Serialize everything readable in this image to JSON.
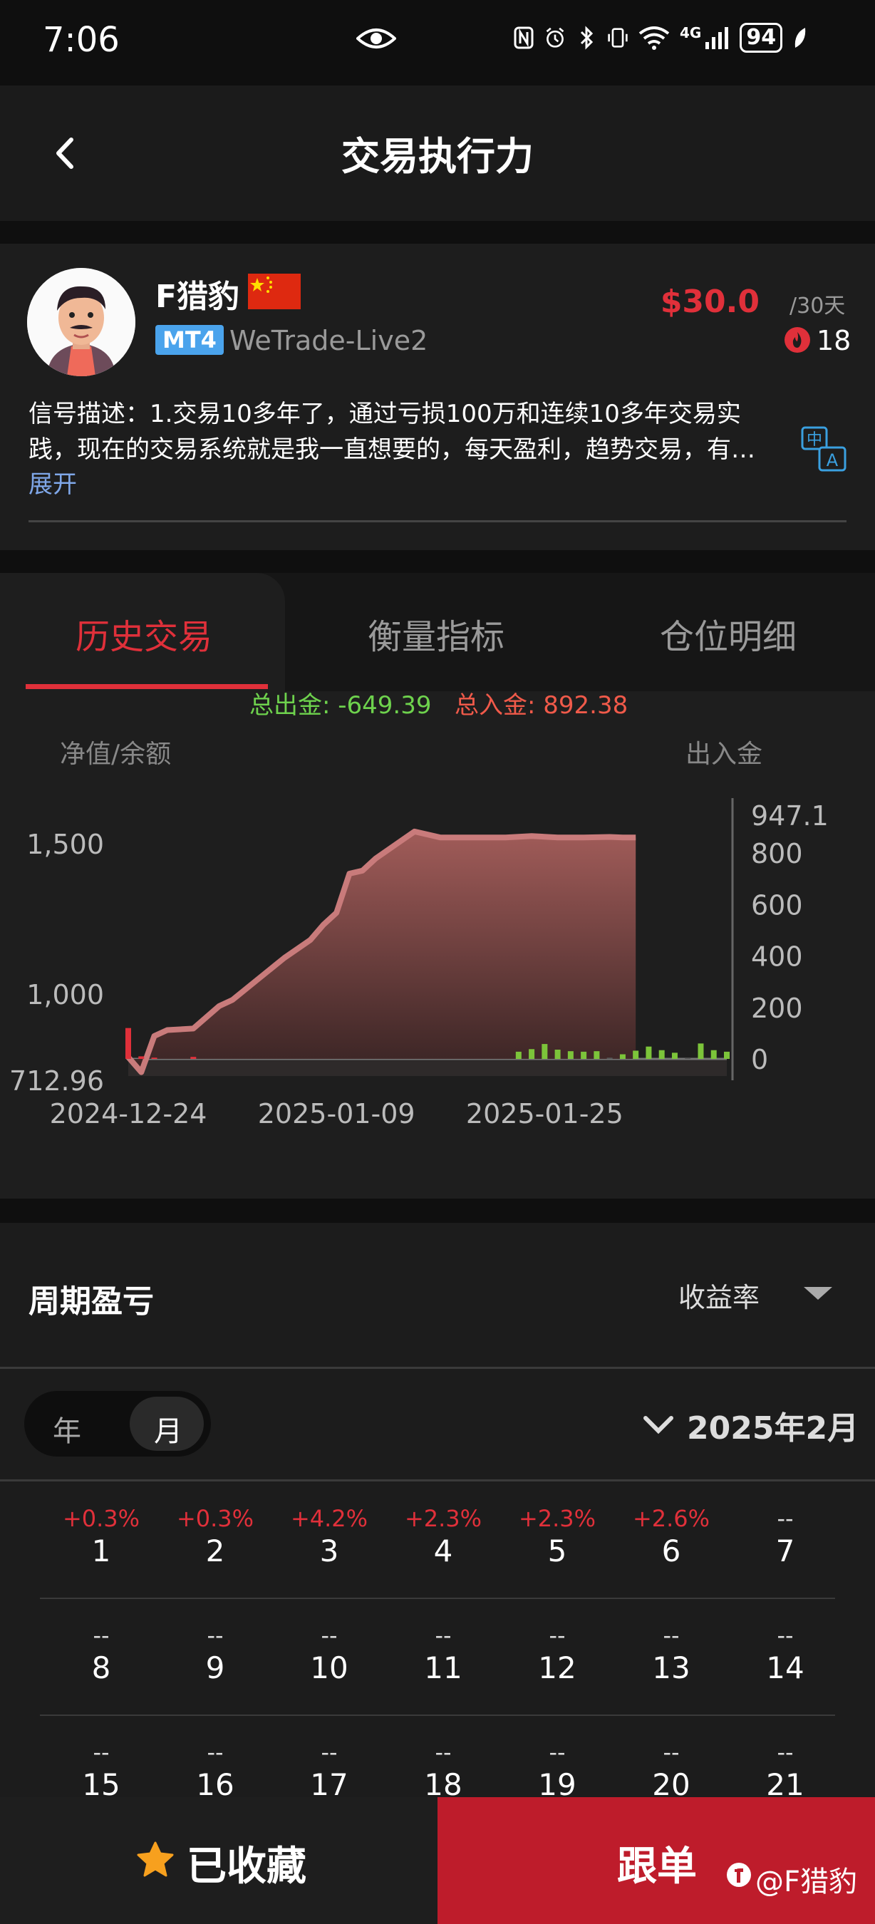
{
  "status_bar": {
    "time": "7:06",
    "network": "4G",
    "battery": "94"
  },
  "header": {
    "title": "交易执行力"
  },
  "trader": {
    "name": "F猎豹",
    "platform": "MT4",
    "server": "WeTrade-Live2",
    "price": "$30.0",
    "period": "/30天",
    "followers": "18",
    "description_line1": "信号描述：1.交易10多年了，通过亏损100万和连续10多年交易实",
    "description_line2": "践，现在的交易系统就是我一直想要的，每天盈利，趋势交易，有…",
    "expand": "展开"
  },
  "tabs": [
    {
      "label": "历史交易"
    },
    {
      "label": "衡量指标"
    },
    {
      "label": "仓位明细"
    }
  ],
  "totals": {
    "out": "总出金: -649.39",
    "in": "总入金: 892.38"
  },
  "chart": {
    "left_title": "净值/余额",
    "right_title": "出入金",
    "left_ticks": [
      "1,500",
      "1,000",
      "712.96"
    ],
    "right_ticks": [
      "947.1",
      "800",
      "600",
      "400",
      "200",
      "0"
    ],
    "x_ticks": [
      "2024-12-24",
      "2025-01-09",
      "2025-01-25"
    ]
  },
  "chart_data": {
    "type": "line",
    "x": [
      "2024-12-24",
      "2024-12-25",
      "2024-12-26",
      "2024-12-27",
      "2024-12-29",
      "2024-12-31",
      "2025-01-01",
      "2025-01-03",
      "2025-01-05",
      "2025-01-07",
      "2025-01-08",
      "2025-01-09",
      "2025-01-10",
      "2025-01-11",
      "2025-01-12",
      "2025-01-14",
      "2025-01-15",
      "2025-01-17",
      "2025-01-18",
      "2025-01-20",
      "2025-01-22",
      "2025-01-24",
      "2025-01-26",
      "2025-01-28",
      "2025-01-30",
      "2025-01-31",
      "2025-02-01"
    ],
    "series": [
      {
        "values": [
          790,
          740,
          860,
          880,
          885,
          960,
          980,
          1050,
          1120,
          1180,
          1230,
          1270,
          1400,
          1410,
          1450,
          1510,
          1540,
          1520,
          1520,
          1520,
          1520,
          1525,
          1520,
          1520,
          1522,
          1520,
          1520
        ]
      }
    ],
    "deposit_bars": {
      "x": [
        "2024-12-24",
        "2024-12-25",
        "2024-12-26",
        "2024-12-29",
        "2025-01-23",
        "2025-01-24",
        "2025-01-25",
        "2025-01-26",
        "2025-01-27",
        "2025-01-28",
        "2025-01-29",
        "2025-01-30",
        "2025-01-31",
        "2025-02-01",
        "2025-02-02",
        "2025-02-03",
        "2025-02-04",
        "2025-02-05",
        "2025-02-06",
        "2025-02-07",
        "2025-02-08"
      ],
      "values": [
        120,
        10,
        5,
        8,
        28,
        38,
        58,
        36,
        30,
        28,
        30,
        5,
        18,
        32,
        48,
        34,
        24,
        5,
        60,
        34,
        28
      ],
      "colors": [
        "#e0303a",
        "#e0303a",
        "#e0303a",
        "#e0303a",
        "#7cc43a",
        "#7cc43a",
        "#7cc43a",
        "#7cc43a",
        "#7cc43a",
        "#7cc43a",
        "#7cc43a",
        "#555555",
        "#7cc43a",
        "#7cc43a",
        "#7cc43a",
        "#7cc43a",
        "#7cc43a",
        "#555555",
        "#7cc43a",
        "#7cc43a",
        "#7cc43a"
      ]
    },
    "ylim_left": [
      712.96,
      1580
    ],
    "ylim_right": [
      0,
      947.1
    ],
    "xlim": [
      "2024-12-24",
      "2025-02-08"
    ],
    "line_color": "#c97b7b"
  },
  "pnl": {
    "title": "周期盈亏",
    "metric": "收益率",
    "seg_year": "年",
    "seg_month": "月",
    "month": "2025年2月",
    "days": [
      {
        "pct": "+0.3%",
        "day": "1"
      },
      {
        "pct": "+0.3%",
        "day": "2"
      },
      {
        "pct": "+4.2%",
        "day": "3"
      },
      {
        "pct": "+2.3%",
        "day": "4"
      },
      {
        "pct": "+2.3%",
        "day": "5"
      },
      {
        "pct": "+2.6%",
        "day": "6"
      },
      {
        "pct": "--",
        "day": "7"
      },
      {
        "pct": "--",
        "day": "8"
      },
      {
        "pct": "--",
        "day": "9"
      },
      {
        "pct": "--",
        "day": "10"
      },
      {
        "pct": "--",
        "day": "11"
      },
      {
        "pct": "--",
        "day": "12"
      },
      {
        "pct": "--",
        "day": "13"
      },
      {
        "pct": "--",
        "day": "14"
      },
      {
        "pct": "--",
        "day": "15"
      },
      {
        "pct": "--",
        "day": "16"
      },
      {
        "pct": "--",
        "day": "17"
      },
      {
        "pct": "--",
        "day": "18"
      },
      {
        "pct": "--",
        "day": "19"
      },
      {
        "pct": "--",
        "day": "20"
      },
      {
        "pct": "--",
        "day": "21"
      }
    ]
  },
  "bottom": {
    "favorite": "已收藏",
    "follow": "跟单",
    "watermark": "@F猎豹"
  },
  "colors": {
    "accent_red": "#e0303a",
    "follow_bg": "#be1c2b",
    "deposit_green": "#7cc43a"
  }
}
